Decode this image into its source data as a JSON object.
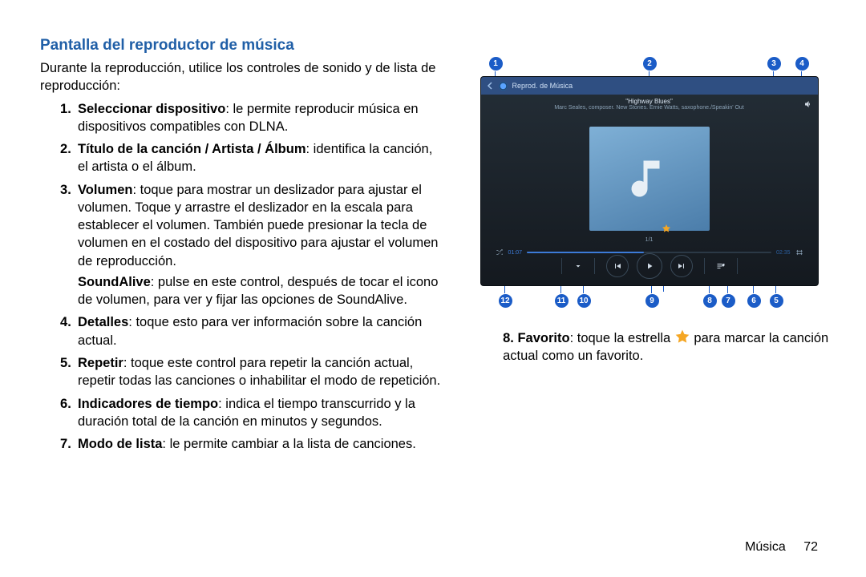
{
  "section_title": "Pantalla del reproductor de música",
  "intro": "Durante la reproducción, utilice los controles de sonido y de lista de reproducción:",
  "list": [
    {
      "bold": "Seleccionar dispositivo",
      "text": ": le permite reproducir música en dispositivos compatibles con DLNA."
    },
    {
      "bold": "Título de la canción / Artista / Álbum",
      "text": ": identifica la canción, el artista o el álbum."
    },
    {
      "bold": "Volumen",
      "text": ": toque para mostrar un deslizador para ajustar el volumen. Toque y arrastre el deslizador en la escala para establecer el volumen. También puede presionar la tecla de volumen en el costado del dispositivo para ajustar el volumen de reproducción.",
      "extra_bold": "SoundAlive",
      "extra_text": ": pulse en este control, después de tocar el icono de volumen, para ver y fijar las opciones de SoundAlive."
    },
    {
      "bold": "Detalles",
      "text": ": toque esto para ver información sobre la canción actual."
    },
    {
      "bold": "Repetir",
      "text": ": toque este control para repetir la canción actual, repetir todas las canciones o inhabilitar el modo de repetición."
    },
    {
      "bold": "Indicadores de tiempo",
      "text": ": indica el tiempo transcurrido y la duración total de la canción en minutos y segundos."
    },
    {
      "bold": "Modo de lista",
      "text": ": le permite cambiar a la lista de canciones."
    }
  ],
  "right_item": {
    "num": "8.",
    "bold": "Favorito",
    "pre": ": toque la estrella ",
    "post": " para marcar la canción actual como un favorito."
  },
  "player": {
    "header": "Reprod. de Música",
    "song": "\"Highway Blues\"",
    "meta": "Marc Seales, composer. New Stories. Ernie Watts, saxophone./Speakin' Out",
    "page": "1/1",
    "elapsed": "01:07",
    "total": "02:35"
  },
  "callouts_top": [
    "1",
    "2",
    "3",
    "4"
  ],
  "callouts_bottom": [
    "12",
    "11",
    "10",
    "9",
    "8",
    "7",
    "6",
    "5"
  ],
  "footer": {
    "section": "Música",
    "page": "72"
  }
}
